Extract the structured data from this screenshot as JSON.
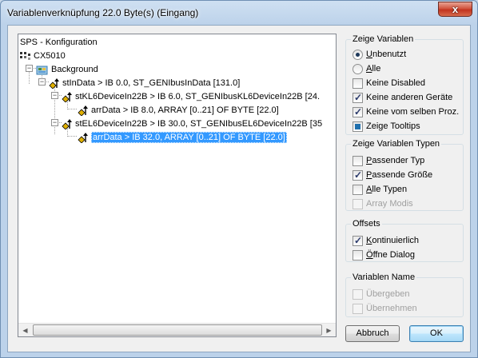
{
  "window": {
    "title": "Variablenverknüpfung 22.0 Byte(s) (Eingang)",
    "close_label": "x"
  },
  "tree": {
    "rows": [
      {
        "text": "SPS - Konfiguration"
      },
      {
        "text": "CX5010"
      },
      {
        "text": "Background"
      },
      {
        "text": "stInData   >   IB 0.0, ST_GENIbusInData [131.0]"
      },
      {
        "text": "stKL6DeviceIn22B   >   IB 6.0, ST_GENIbusKL6DeviceIn22B [24."
      },
      {
        "text": "arrData   >   IB 8.0, ARRAY [0..21] OF BYTE [22.0]"
      },
      {
        "text": "stEL6DeviceIn22B   >   IB 30.0, ST_GENIbusEL6DeviceIn22B [35"
      },
      {
        "text": "arrData   >   IB 32.0, ARRAY [0..21] OF BYTE [22.0]"
      }
    ]
  },
  "groups": {
    "zeige_variablen": {
      "title": "Zeige Variablen",
      "options": [
        {
          "label": "Unbenutzt",
          "mn": "U",
          "rest": "nbenutzt",
          "type": "radio",
          "checked": true
        },
        {
          "label": "Alle",
          "mn": "A",
          "rest": "lle",
          "type": "radio",
          "checked": false
        },
        {
          "label": "Keine Disabled",
          "type": "checkbox",
          "checked": false
        },
        {
          "label": "Keine anderen Geräte",
          "type": "checkbox",
          "checked": true
        },
        {
          "label": "Keine vom selben Proz.",
          "type": "checkbox",
          "checked": true
        },
        {
          "label": "Zeige Tooltips",
          "type": "checkbox",
          "checked": true
        }
      ]
    },
    "zeige_typen": {
      "title": "Zeige Variablen Typen",
      "options": [
        {
          "label": "Passender Typ",
          "mn": "P",
          "rest": "assender Typ",
          "checked": false
        },
        {
          "label": "Passende Größe",
          "mn": "P",
          "rest": "assende Größe",
          "checked": true
        },
        {
          "label": "Alle Typen",
          "mn": "A",
          "rest": "lle Typen",
          "checked": false
        },
        {
          "label": "Array Modis",
          "checked": false,
          "disabled": true
        }
      ]
    },
    "offsets": {
      "title": "Offsets",
      "options": [
        {
          "label": "Kontinuierlich",
          "mn": "K",
          "rest": "ontinuierlich",
          "checked": true
        },
        {
          "label": "Öffne Dialog",
          "mn": "Ö",
          "rest": "ffne Dialog",
          "checked": false
        }
      ]
    },
    "variablen_name": {
      "title": "Variablen Name",
      "options": [
        {
          "label": "Übergeben",
          "checked": false,
          "disabled": true
        },
        {
          "label": "Übernehmen",
          "checked": false,
          "disabled": true
        }
      ]
    }
  },
  "buttons": {
    "cancel": "Abbruch",
    "ok": "OK"
  }
}
